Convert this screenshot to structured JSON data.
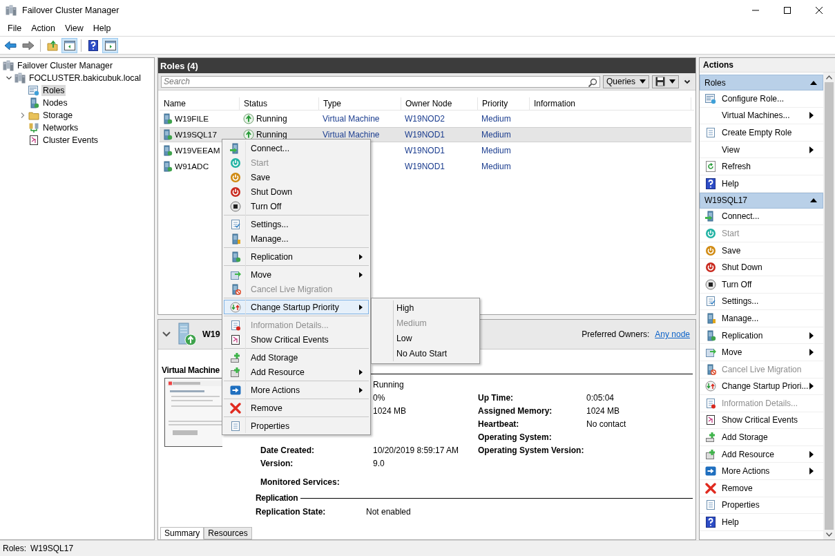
{
  "window": {
    "title": "Failover Cluster Manager"
  },
  "menu": [
    "File",
    "Action",
    "View",
    "Help"
  ],
  "toolbar": [
    {
      "pressed": false
    },
    {
      "pressed": false
    },
    {
      "pressed": false
    },
    {
      "pressed": true
    },
    {
      "pressed": false
    },
    {
      "pressed": true
    }
  ],
  "tree": [
    {
      "label": "Failover Cluster Manager",
      "selected": false,
      "children": [
        {
          "label": "FOCLUSTER.bakicubuk.local",
          "selected": false,
          "expanded": true,
          "children": [
            {
              "label": "Roles",
              "selected": true
            },
            {
              "label": "Nodes",
              "selected": false
            },
            {
              "label": "Storage",
              "selected": false,
              "expanded": false
            },
            {
              "label": "Networks",
              "selected": false
            },
            {
              "label": "Cluster Events",
              "selected": false
            }
          ]
        }
      ]
    }
  ],
  "roles_panel": {
    "title": "Roles (4)",
    "search": {
      "placeholder": "Search"
    },
    "queries_button": "Queries",
    "columns": [
      "Name",
      "Status",
      "Type",
      "Owner Node",
      "Priority",
      "Information"
    ],
    "rows": [
      {
        "name": "W19FILE",
        "status": "Running",
        "type": "Virtual Machine",
        "owner_node": "W19NOD2",
        "priority": "Medium",
        "selected": false
      },
      {
        "name": "W19SQL17",
        "status": "Running",
        "type": "Virtual Machine",
        "owner_node": "W19NOD1",
        "priority": "Medium",
        "selected": true
      },
      {
        "name": "W19VEEAM",
        "owner_node": "W19NOD1",
        "priority": "Medium",
        "selected": false
      },
      {
        "name": "W91ADC",
        "owner_node": "W19NOD1",
        "priority": "Medium",
        "selected": false
      }
    ]
  },
  "context_menu": {
    "items": [
      {
        "kind": "item",
        "label": "Connect...",
        "disabled": false,
        "submenu": false,
        "selected": false
      },
      {
        "kind": "item",
        "label": "Start",
        "disabled": true,
        "submenu": false,
        "selected": false
      },
      {
        "kind": "item",
        "label": "Save",
        "disabled": false,
        "submenu": false,
        "selected": false
      },
      {
        "kind": "item",
        "label": "Shut Down",
        "disabled": false,
        "submenu": false,
        "selected": false
      },
      {
        "kind": "item",
        "label": "Turn Off",
        "disabled": false,
        "submenu": false,
        "selected": false
      },
      {
        "kind": "separator"
      },
      {
        "kind": "item",
        "label": "Settings...",
        "disabled": false,
        "submenu": false,
        "selected": false
      },
      {
        "kind": "item",
        "label": "Manage...",
        "disabled": false,
        "submenu": false,
        "selected": false
      },
      {
        "kind": "separator"
      },
      {
        "kind": "item",
        "label": "Replication",
        "disabled": false,
        "submenu": true,
        "selected": false
      },
      {
        "kind": "separator"
      },
      {
        "kind": "item",
        "label": "Move",
        "disabled": false,
        "submenu": true,
        "selected": false
      },
      {
        "kind": "item",
        "label": "Cancel Live Migration",
        "disabled": true,
        "submenu": false,
        "selected": false
      },
      {
        "kind": "separator"
      },
      {
        "kind": "item",
        "label": "Change Startup Priority",
        "disabled": false,
        "submenu": true,
        "selected": true
      },
      {
        "kind": "separator"
      },
      {
        "kind": "item",
        "label": "Information Details...",
        "disabled": true,
        "submenu": false,
        "selected": false
      },
      {
        "kind": "item",
        "label": "Show Critical Events",
        "disabled": false,
        "submenu": false,
        "selected": false
      },
      {
        "kind": "separator"
      },
      {
        "kind": "item",
        "label": "Add Storage",
        "disabled": false,
        "submenu": false,
        "selected": false
      },
      {
        "kind": "item",
        "label": "Add Resource",
        "disabled": false,
        "submenu": true,
        "selected": false
      },
      {
        "kind": "separator"
      },
      {
        "kind": "item",
        "label": "More Actions",
        "disabled": false,
        "submenu": true,
        "selected": false
      },
      {
        "kind": "separator"
      },
      {
        "kind": "item",
        "label": "Remove",
        "disabled": false,
        "submenu": false,
        "selected": false
      },
      {
        "kind": "separator"
      },
      {
        "kind": "item",
        "label": "Properties",
        "disabled": false,
        "submenu": false,
        "selected": false
      }
    ]
  },
  "submenu": {
    "items": [
      {
        "label": "High",
        "disabled": false
      },
      {
        "label": "Medium",
        "disabled": true
      },
      {
        "label": "Low",
        "disabled": false
      },
      {
        "label": "No Auto Start",
        "disabled": false
      }
    ]
  },
  "details": {
    "title": "W19",
    "preferred_owners_label": "Preferred Owners:",
    "preferred_owners_link": "Any node",
    "expanded": true,
    "section": "Virtual Machine",
    "rows": [
      {
        "value": "Running"
      },
      {
        "value": "0%",
        "label_2": "Up Time:",
        "value_2": "0:05:04"
      },
      {
        "value": "1024 MB",
        "label_2": "Assigned Memory:",
        "value_2": "1024 MB"
      },
      {
        "label_2": "Heartbeat:",
        "value_2": "No contact"
      },
      {
        "label_2": "Operating System:"
      },
      {
        "label": "Date Created:",
        "value": "10/20/2019 8:59:17 AM",
        "label_2": "Operating System Version:"
      },
      {
        "label": "Version:",
        "value": "9.0"
      },
      {
        "label": "Monitored Services:"
      }
    ],
    "replication_heading": "Replication",
    "replication_rows": [
      {
        "label": "Replication State:",
        "value": "Not enabled"
      }
    ],
    "tabs": [
      {
        "label": "Summary",
        "selected": true
      },
      {
        "label": "Resources",
        "selected": false
      }
    ]
  },
  "actions": {
    "title": "Actions",
    "sections": [
      {
        "title": "Roles",
        "expanded": true,
        "items": [
          {
            "label": "Configure Role...",
            "disabled": false,
            "submenu": false
          },
          {
            "label": "Virtual Machines...",
            "disabled": false,
            "submenu": true
          },
          {
            "label": "Create Empty Role",
            "disabled": false,
            "submenu": false
          },
          {
            "label": "View",
            "disabled": false,
            "submenu": true
          },
          {
            "label": "Refresh",
            "disabled": false,
            "submenu": false
          },
          {
            "label": "Help",
            "disabled": false,
            "submenu": false
          }
        ]
      },
      {
        "title": "W19SQL17",
        "expanded": true,
        "items": [
          {
            "label": "Connect...",
            "disabled": false,
            "submenu": false
          },
          {
            "label": "Start",
            "disabled": true,
            "submenu": false
          },
          {
            "label": "Save",
            "disabled": false,
            "submenu": false
          },
          {
            "label": "Shut Down",
            "disabled": false,
            "submenu": false
          },
          {
            "label": "Turn Off",
            "disabled": false,
            "submenu": false
          },
          {
            "label": "Settings...",
            "disabled": false,
            "submenu": false
          },
          {
            "label": "Manage...",
            "disabled": false,
            "submenu": false
          },
          {
            "label": "Replication",
            "disabled": false,
            "submenu": true
          },
          {
            "label": "Move",
            "disabled": false,
            "submenu": true
          },
          {
            "label": "Cancel Live Migration",
            "disabled": true,
            "submenu": false
          },
          {
            "label": "Change Startup Priori...",
            "disabled": false,
            "submenu": true
          },
          {
            "label": "Information Details...",
            "disabled": true,
            "submenu": false
          },
          {
            "label": "Show Critical Events",
            "disabled": false,
            "submenu": false
          },
          {
            "label": "Add Storage",
            "disabled": false,
            "submenu": false
          },
          {
            "label": "Add Resource",
            "disabled": false,
            "submenu": true
          },
          {
            "label": "More Actions",
            "disabled": false,
            "submenu": true
          },
          {
            "label": "Remove",
            "disabled": false,
            "submenu": false
          },
          {
            "label": "Properties",
            "disabled": false,
            "submenu": false
          },
          {
            "label": "Help",
            "disabled": false,
            "submenu": false
          }
        ]
      }
    ]
  },
  "status_bar": {
    "label": "Roles:",
    "value": "W19SQL17"
  }
}
